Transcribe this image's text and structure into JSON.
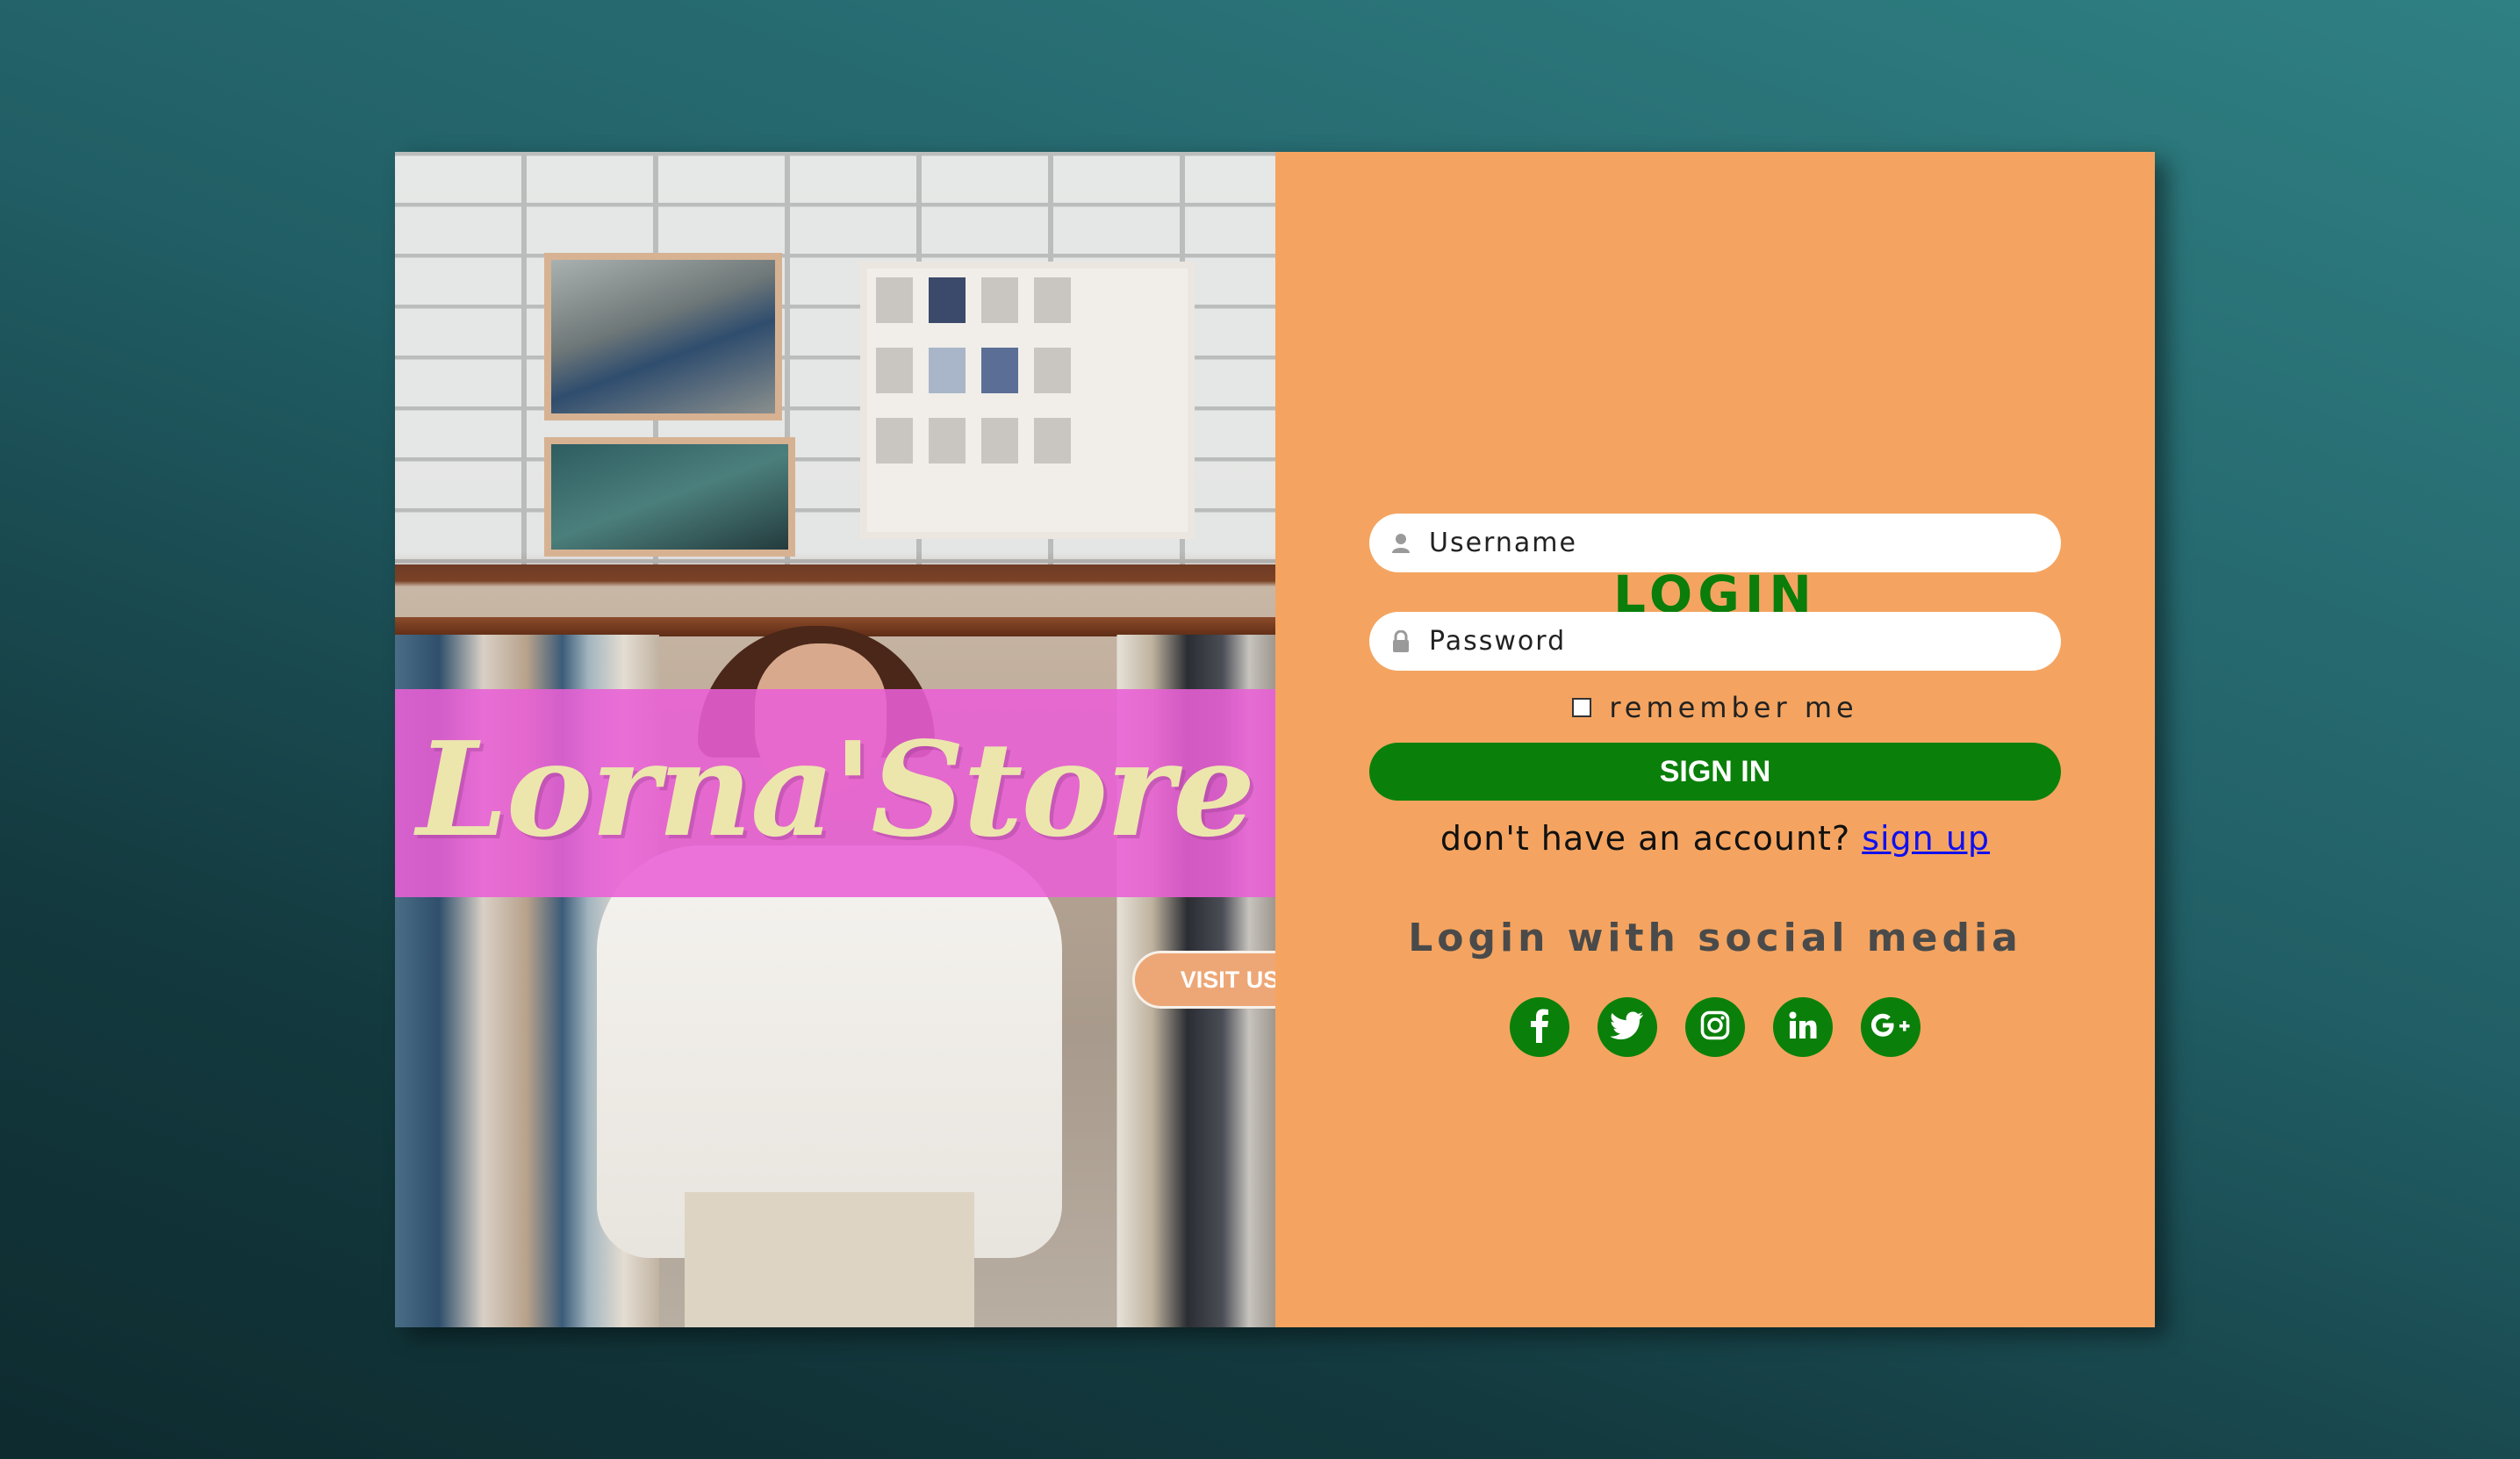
{
  "brand": {
    "name": "Lorna'Store",
    "visit_label": "VISIT US"
  },
  "login": {
    "title": "LOGIN",
    "username_placeholder": "Username",
    "password_placeholder": "Password",
    "remember_label": "remember me",
    "signin_label": "SIGN IN",
    "no_account_text": "don't have an account? ",
    "signup_label": "sign up",
    "social_title": "Login with social media",
    "social_icons": [
      "facebook-icon",
      "twitter-icon",
      "instagram-icon",
      "linkedin-icon",
      "google-plus-icon"
    ]
  },
  "colors": {
    "background": "#215e65",
    "form_panel": "#f4a460",
    "accent_green": "#0a800a",
    "banner_pink": "#e960d6",
    "brand_text": "#ece6ad",
    "link_blue": "#1010ee"
  }
}
